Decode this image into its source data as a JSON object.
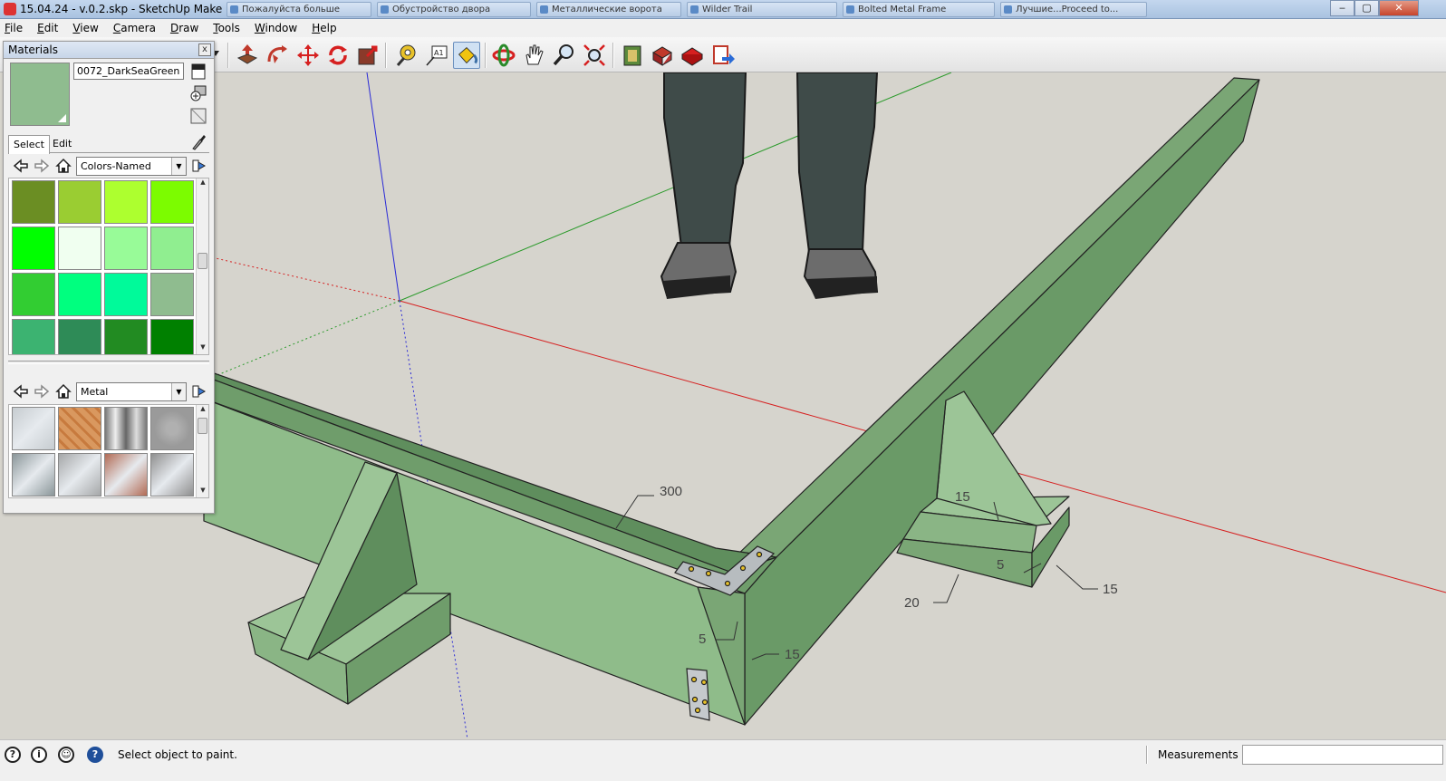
{
  "window": {
    "title": "15.04.24 - v.0.2.skp - SketchUp Make",
    "background_tabs": [
      "Пожалуйста больше",
      "Обустройство двора",
      "Металлические ворота",
      "Wilder Trail",
      "Bolted Metal Frame",
      "Лучшие...Proceed to..."
    ],
    "controls": {
      "minimize": "‒",
      "maximize": "▢",
      "close": "✕"
    }
  },
  "menu": [
    "File",
    "Edit",
    "View",
    "Camera",
    "Draw",
    "Tools",
    "Window",
    "Help"
  ],
  "toolbar": {
    "tools": [
      "select-tool",
      "push-pull-tool",
      "follow-me-tool",
      "move-tool",
      "rotate-tool",
      "scale-tool",
      "tape-measure-tool",
      "text-tool",
      "paint-bucket-tool",
      "orbit-tool",
      "pan-tool",
      "zoom-tool",
      "zoom-extents-tool",
      "warehouse-tool",
      "share-model-tool",
      "extension-tool",
      "send-to-layout-tool"
    ]
  },
  "materials_panel": {
    "title": "Materials",
    "close_label": "x",
    "current_material": "0072_DarkSeaGreen",
    "current_color": "#8fbc8f",
    "tabs": {
      "select": "Select",
      "edit": "Edit"
    },
    "library_1": {
      "name": "Colors-Named",
      "swatches": [
        "#6b8e23",
        "#9acd32",
        "#adff2f",
        "#7cfc00",
        "#00ff00",
        "#f0fff0",
        "#98fb98",
        "#90ee90",
        "#32cd32",
        "#00ff7f",
        "#00fa9a",
        "#8fbc8f",
        "#3cb371",
        "#2e8b57",
        "#228b22",
        "#008000"
      ]
    },
    "library_2": {
      "name": "Metal",
      "swatches": [
        "#c6ccd0",
        "#d9985f",
        "#b8b8b8",
        "#9a9a9a",
        "#8a9699",
        "#a5a7a8",
        "#b26b55",
        "#8f8f8f"
      ]
    }
  },
  "dimensions": {
    "d300": "300",
    "d15_front": "15",
    "d5_front": "5",
    "d20": "20",
    "d5_right": "5",
    "d15_right": "15",
    "d15_top": "15"
  },
  "status": {
    "text": "Select object to paint.",
    "measurements_label": "Measurements",
    "measurements_value": ""
  }
}
